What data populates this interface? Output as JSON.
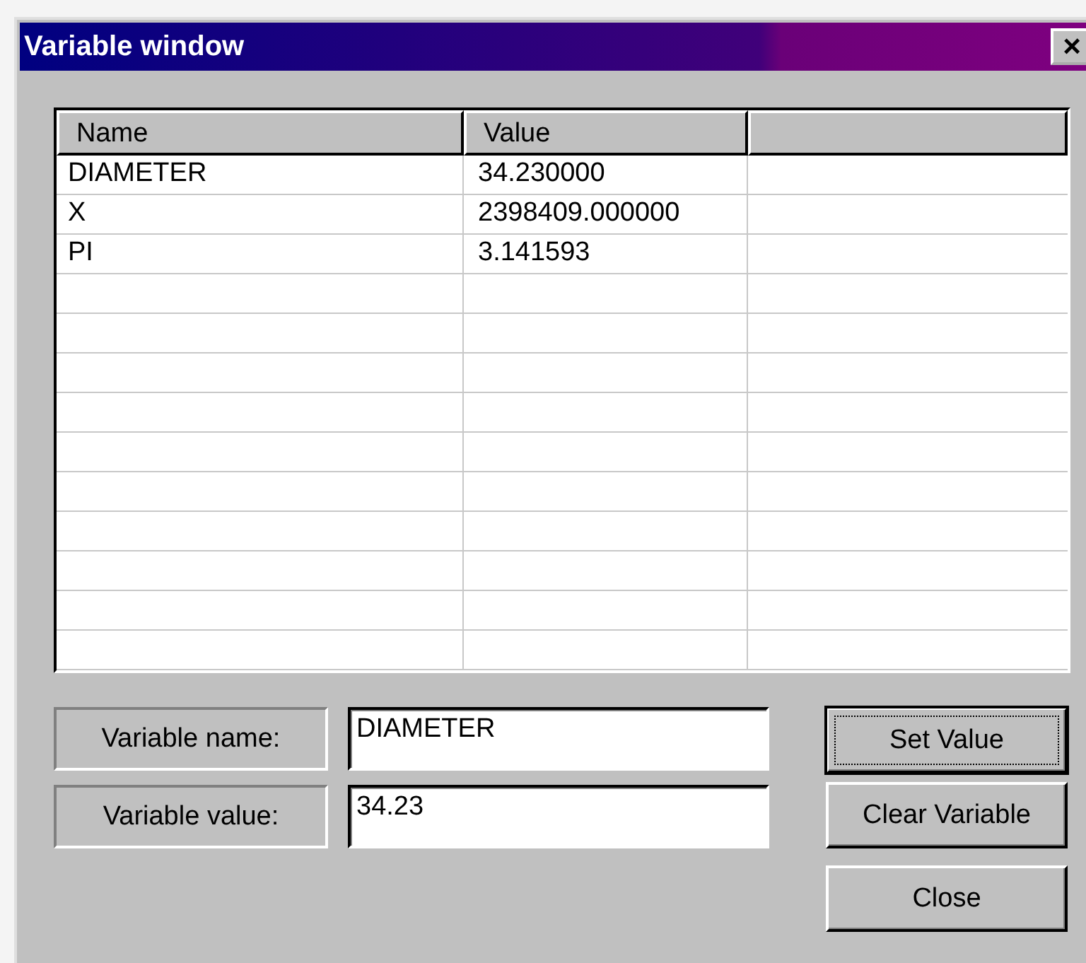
{
  "window": {
    "title": "Variable window",
    "close": "×"
  },
  "table": {
    "columns": [
      "Name",
      "Value"
    ],
    "rows": [
      {
        "name": "DIAMETER",
        "value": "34.230000"
      },
      {
        "name": "X",
        "value": "2398409.000000"
      },
      {
        "name": "PI",
        "value": "3.141593"
      }
    ]
  },
  "fields": [
    {
      "label": "Variable name:",
      "value": "DIAMETER"
    },
    {
      "label": "Variable value:",
      "value": "34.23"
    }
  ],
  "buttons": [
    {
      "label": "Set Value",
      "default": true
    },
    {
      "label": "Clear Variable",
      "default": false
    },
    {
      "label": "Close",
      "default": false
    }
  ]
}
